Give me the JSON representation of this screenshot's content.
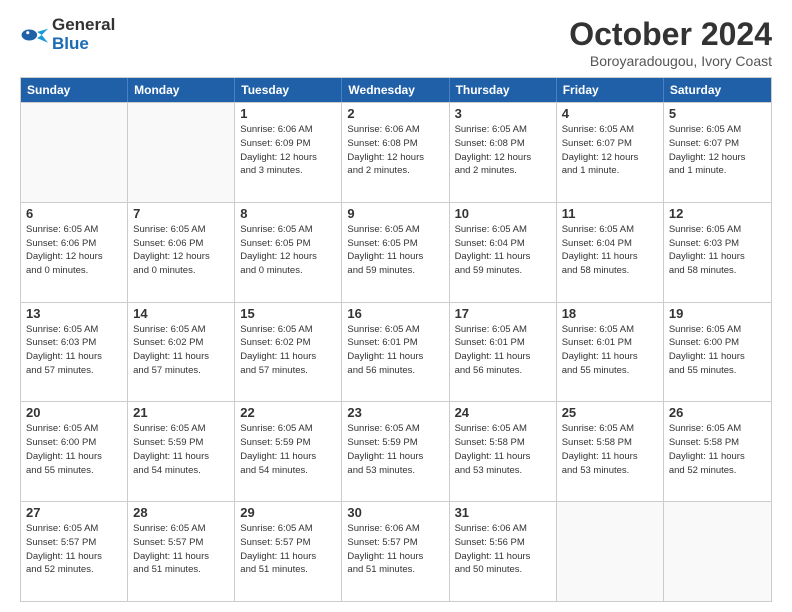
{
  "logo": {
    "line1": "General",
    "line2": "Blue"
  },
  "title": "October 2024",
  "location": "Boroyaradougou, Ivory Coast",
  "header_days": [
    "Sunday",
    "Monday",
    "Tuesday",
    "Wednesday",
    "Thursday",
    "Friday",
    "Saturday"
  ],
  "weeks": [
    [
      {
        "day": "",
        "info": ""
      },
      {
        "day": "",
        "info": ""
      },
      {
        "day": "1",
        "info": "Sunrise: 6:06 AM\nSunset: 6:09 PM\nDaylight: 12 hours\nand 3 minutes."
      },
      {
        "day": "2",
        "info": "Sunrise: 6:06 AM\nSunset: 6:08 PM\nDaylight: 12 hours\nand 2 minutes."
      },
      {
        "day": "3",
        "info": "Sunrise: 6:05 AM\nSunset: 6:08 PM\nDaylight: 12 hours\nand 2 minutes."
      },
      {
        "day": "4",
        "info": "Sunrise: 6:05 AM\nSunset: 6:07 PM\nDaylight: 12 hours\nand 1 minute."
      },
      {
        "day": "5",
        "info": "Sunrise: 6:05 AM\nSunset: 6:07 PM\nDaylight: 12 hours\nand 1 minute."
      }
    ],
    [
      {
        "day": "6",
        "info": "Sunrise: 6:05 AM\nSunset: 6:06 PM\nDaylight: 12 hours\nand 0 minutes."
      },
      {
        "day": "7",
        "info": "Sunrise: 6:05 AM\nSunset: 6:06 PM\nDaylight: 12 hours\nand 0 minutes."
      },
      {
        "day": "8",
        "info": "Sunrise: 6:05 AM\nSunset: 6:05 PM\nDaylight: 12 hours\nand 0 minutes."
      },
      {
        "day": "9",
        "info": "Sunrise: 6:05 AM\nSunset: 6:05 PM\nDaylight: 11 hours\nand 59 minutes."
      },
      {
        "day": "10",
        "info": "Sunrise: 6:05 AM\nSunset: 6:04 PM\nDaylight: 11 hours\nand 59 minutes."
      },
      {
        "day": "11",
        "info": "Sunrise: 6:05 AM\nSunset: 6:04 PM\nDaylight: 11 hours\nand 58 minutes."
      },
      {
        "day": "12",
        "info": "Sunrise: 6:05 AM\nSunset: 6:03 PM\nDaylight: 11 hours\nand 58 minutes."
      }
    ],
    [
      {
        "day": "13",
        "info": "Sunrise: 6:05 AM\nSunset: 6:03 PM\nDaylight: 11 hours\nand 57 minutes."
      },
      {
        "day": "14",
        "info": "Sunrise: 6:05 AM\nSunset: 6:02 PM\nDaylight: 11 hours\nand 57 minutes."
      },
      {
        "day": "15",
        "info": "Sunrise: 6:05 AM\nSunset: 6:02 PM\nDaylight: 11 hours\nand 57 minutes."
      },
      {
        "day": "16",
        "info": "Sunrise: 6:05 AM\nSunset: 6:01 PM\nDaylight: 11 hours\nand 56 minutes."
      },
      {
        "day": "17",
        "info": "Sunrise: 6:05 AM\nSunset: 6:01 PM\nDaylight: 11 hours\nand 56 minutes."
      },
      {
        "day": "18",
        "info": "Sunrise: 6:05 AM\nSunset: 6:01 PM\nDaylight: 11 hours\nand 55 minutes."
      },
      {
        "day": "19",
        "info": "Sunrise: 6:05 AM\nSunset: 6:00 PM\nDaylight: 11 hours\nand 55 minutes."
      }
    ],
    [
      {
        "day": "20",
        "info": "Sunrise: 6:05 AM\nSunset: 6:00 PM\nDaylight: 11 hours\nand 55 minutes."
      },
      {
        "day": "21",
        "info": "Sunrise: 6:05 AM\nSunset: 5:59 PM\nDaylight: 11 hours\nand 54 minutes."
      },
      {
        "day": "22",
        "info": "Sunrise: 6:05 AM\nSunset: 5:59 PM\nDaylight: 11 hours\nand 54 minutes."
      },
      {
        "day": "23",
        "info": "Sunrise: 6:05 AM\nSunset: 5:59 PM\nDaylight: 11 hours\nand 53 minutes."
      },
      {
        "day": "24",
        "info": "Sunrise: 6:05 AM\nSunset: 5:58 PM\nDaylight: 11 hours\nand 53 minutes."
      },
      {
        "day": "25",
        "info": "Sunrise: 6:05 AM\nSunset: 5:58 PM\nDaylight: 11 hours\nand 53 minutes."
      },
      {
        "day": "26",
        "info": "Sunrise: 6:05 AM\nSunset: 5:58 PM\nDaylight: 11 hours\nand 52 minutes."
      }
    ],
    [
      {
        "day": "27",
        "info": "Sunrise: 6:05 AM\nSunset: 5:57 PM\nDaylight: 11 hours\nand 52 minutes."
      },
      {
        "day": "28",
        "info": "Sunrise: 6:05 AM\nSunset: 5:57 PM\nDaylight: 11 hours\nand 51 minutes."
      },
      {
        "day": "29",
        "info": "Sunrise: 6:05 AM\nSunset: 5:57 PM\nDaylight: 11 hours\nand 51 minutes."
      },
      {
        "day": "30",
        "info": "Sunrise: 6:06 AM\nSunset: 5:57 PM\nDaylight: 11 hours\nand 51 minutes."
      },
      {
        "day": "31",
        "info": "Sunrise: 6:06 AM\nSunset: 5:56 PM\nDaylight: 11 hours\nand 50 minutes."
      },
      {
        "day": "",
        "info": ""
      },
      {
        "day": "",
        "info": ""
      }
    ]
  ]
}
